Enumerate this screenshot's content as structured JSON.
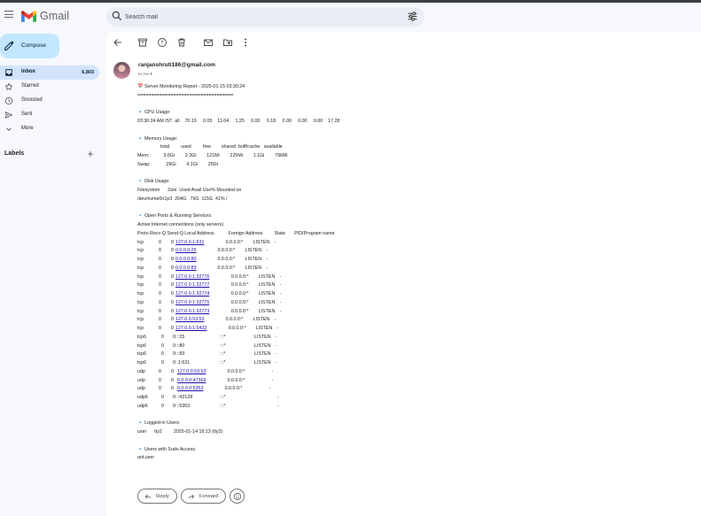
{
  "app": {
    "name": "Gmail"
  },
  "search": {
    "placeholder": "Search mail"
  },
  "sidebar": {
    "compose": "Compose",
    "items": [
      {
        "label": "Inbox",
        "count": "6,803",
        "icon": "inbox-icon",
        "active": true
      },
      {
        "label": "Starred",
        "icon": "star-icon"
      },
      {
        "label": "Snoozed",
        "icon": "clock-icon"
      },
      {
        "label": "Sent",
        "icon": "send-icon"
      },
      {
        "label": "More",
        "icon": "chevron-down-icon"
      }
    ],
    "labels_title": "Labels"
  },
  "message": {
    "sender": "ranjanshruti186@gmail.com",
    "to": "to me",
    "body": {
      "title": "📅 Server Monitoring Report - 2025-01-15 03:30:24",
      "rule": "===================================",
      "cpu_heading": "CPU Usage:",
      "cpu_line": "03:30:24 AM IST  all    70.19     0.05    11.04     1.25     0.00     0.18     0.00     0.00     0.00    17.28",
      "mem_heading": "Memory Usage:",
      "mem_header": "total         used         free        shared  buff/cache   available",
      "mem_row": "Mem:           3.6Gi        2.3Gi        121Mi        225Mi        1.1Gi        796Mi",
      "swap_row": "Swap:            29Gi        4.1Gi        25Gi",
      "disk_heading": "Disk Usage:",
      "disk_header": "Filesystem      Size  Used Avail Use% Mounted on",
      "disk_row": "/dev/nvme0n1p3  204G   79G  115G  41% /",
      "ports_heading": "Open Ports & Running Services:",
      "ports_sub": "Active Internet connections (only servers)",
      "ports_header": "Proto Recv-Q Send-Q Local Address           Foreign Address         State       PID/Program name",
      "ports": [
        {
          "proto": "tcp",
          "recv": "0",
          "send": "0",
          "local": "127.0.0.1:631",
          "foreign": "0.0.0.0:*",
          "state": "LISTEN",
          "pid": "-"
        },
        {
          "proto": "tcp",
          "recv": "0",
          "send": "0",
          "local": "0.0.0.0:25",
          "foreign": "0.0.0.0:*",
          "state": "LISTEN",
          "pid": "-"
        },
        {
          "proto": "tcp",
          "recv": "0",
          "send": "0",
          "local": "0.0.0.0:80",
          "foreign": "0.0.0.0:*",
          "state": "LISTEN",
          "pid": "-"
        },
        {
          "proto": "tcp",
          "recv": "0",
          "send": "0",
          "local": "0.0.0.0:83",
          "foreign": "0.0.0.0:*",
          "state": "LISTEN",
          "pid": "-"
        },
        {
          "proto": "tcp",
          "recv": "0",
          "send": "0",
          "local": "127.0.0.1:32776",
          "foreign": "0.0.0.0:*",
          "state": "LISTEN",
          "pid": "-"
        },
        {
          "proto": "tcp",
          "recv": "0",
          "send": "0",
          "local": "127.0.0.1:32777",
          "foreign": "0.0.0.0:*",
          "state": "LISTEN",
          "pid": "-"
        },
        {
          "proto": "tcp",
          "recv": "0",
          "send": "0",
          "local": "127.0.0.1:32774",
          "foreign": "0.0.0.0:*",
          "state": "LISTEN",
          "pid": "-"
        },
        {
          "proto": "tcp",
          "recv": "0",
          "send": "0",
          "local": "127.0.0.1:32775",
          "foreign": "0.0.0.0:*",
          "state": "LISTEN",
          "pid": "-"
        },
        {
          "proto": "tcp",
          "recv": "0",
          "send": "0",
          "local": "127.0.0.1:32773",
          "foreign": "0.0.0.0:*",
          "state": "LISTEN",
          "pid": "-"
        },
        {
          "proto": "tcp",
          "recv": "0",
          "send": "0",
          "local": "127.0.0.53:53",
          "foreign": "0.0.0.0:*",
          "state": "LISTEN",
          "pid": "-"
        },
        {
          "proto": "tcp",
          "recv": "0",
          "send": "0",
          "local": "127.0.0.1:5432",
          "foreign": "0.0.0.0:*",
          "state": "LISTEN",
          "pid": "-"
        },
        {
          "proto": "tcp6",
          "recv": "0",
          "send": "0",
          "local": ":::25",
          "foreign": ":::*",
          "state": "LISTEN",
          "pid": "-"
        },
        {
          "proto": "tcp6",
          "recv": "0",
          "send": "0",
          "local": ":::80",
          "foreign": ":::*",
          "state": "LISTEN",
          "pid": "-"
        },
        {
          "proto": "tcp6",
          "recv": "0",
          "send": "0",
          "local": ":::83",
          "foreign": ":::*",
          "state": "LISTEN",
          "pid": "-"
        },
        {
          "proto": "tcp6",
          "recv": "0",
          "send": "0",
          "local": "::1:631",
          "foreign": ":::*",
          "state": "LISTEN",
          "pid": "-"
        },
        {
          "proto": "udp",
          "recv": "0",
          "send": "0",
          "local": "127.0.0.53:53",
          "foreign": "0.0.0.0:*",
          "state": "",
          "pid": "-"
        },
        {
          "proto": "udp",
          "recv": "0",
          "send": "0",
          "local": "0.0.0.0:47369",
          "foreign": "0.0.0.0:*",
          "state": "",
          "pid": "-"
        },
        {
          "proto": "udp",
          "recv": "0",
          "send": "0",
          "local": "0.0.0.0:5353",
          "foreign": "0.0.0.0:*",
          "state": "",
          "pid": "-"
        },
        {
          "proto": "udp6",
          "recv": "0",
          "send": "0",
          "local": ":::42128",
          "foreign": ":::*",
          "state": "",
          "pid": "-"
        },
        {
          "proto": "udp6",
          "recv": "0",
          "send": "0",
          "local": ":::5353",
          "foreign": ":::*",
          "state": "",
          "pid": "-"
        }
      ],
      "users_heading": "Logged-in Users:",
      "users_row": "user      tty2         2025-01-14 19:13 (tty2)",
      "sudo_heading": "Users with Sudo Access:",
      "sudo_row": "ant,user"
    }
  },
  "actions": {
    "reply": "Reply",
    "forward": "Forward"
  },
  "colors": {
    "accent": "#c2e7ff",
    "active_nav": "#d3e3fd",
    "link": "#1a0dab",
    "bullet": "#1a73e8"
  }
}
